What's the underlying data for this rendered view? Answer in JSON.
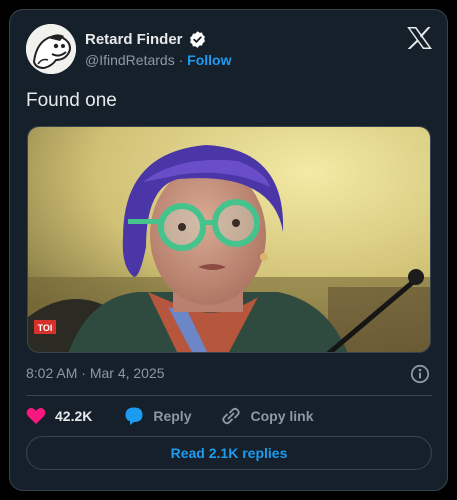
{
  "author": {
    "name": "Retard Finder",
    "handle": "@IfindRetards",
    "separator": "·",
    "follow_label": "Follow"
  },
  "tweet": {
    "text": "Found one",
    "media_watermark": "TOI",
    "time": "8:02 AM",
    "date_separator": "·",
    "date": "Mar 4, 2025"
  },
  "actions": {
    "like_count": "42.2K",
    "reply_label": "Reply",
    "copy_link_label": "Copy link"
  },
  "replies_button_label": "Read 2.1K replies",
  "colors": {
    "card_bg": "#15202b",
    "border": "#38444d",
    "accent_blue": "#1d9bf0",
    "like_pink": "#f91880",
    "muted_text": "#8b98a5"
  },
  "icons": [
    "verified-badge-icon",
    "x-logo-icon",
    "info-icon",
    "heart-icon",
    "reply-bubble-icon",
    "link-icon"
  ]
}
